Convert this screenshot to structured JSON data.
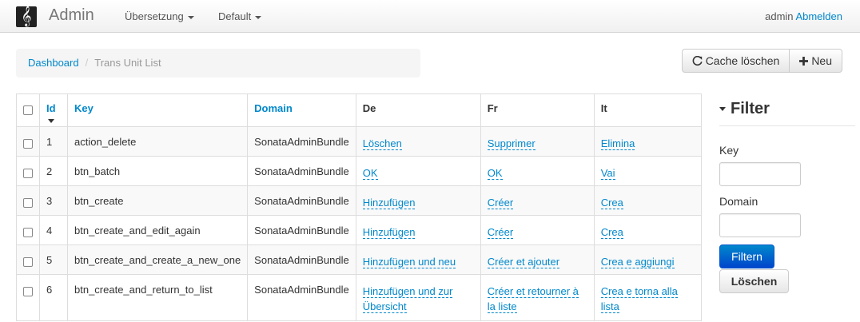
{
  "navbar": {
    "brand": "Admin",
    "menu": [
      {
        "label": "Übersetzung"
      },
      {
        "label": "Default"
      }
    ],
    "user": "admin",
    "logout": "Abmelden"
  },
  "breadcrumb": {
    "home": "Dashboard",
    "current": "Trans Unit List"
  },
  "actions": {
    "cache_clear": "Cache löschen",
    "new": "Neu"
  },
  "table": {
    "headers": {
      "id": "Id",
      "key": "Key",
      "domain": "Domain",
      "de": "De",
      "fr": "Fr",
      "it": "It"
    },
    "rows": [
      {
        "id": "1",
        "key": "action_delete",
        "domain": "SonataAdminBundle",
        "de": "Löschen",
        "fr": "Supprimer",
        "it": "Elimina"
      },
      {
        "id": "2",
        "key": "btn_batch",
        "domain": "SonataAdminBundle",
        "de": "OK",
        "fr": "OK",
        "it": "Vai"
      },
      {
        "id": "3",
        "key": "btn_create",
        "domain": "SonataAdminBundle",
        "de": "Hinzufügen",
        "fr": "Créer",
        "it": "Crea"
      },
      {
        "id": "4",
        "key": "btn_create_and_edit_again",
        "domain": "SonataAdminBundle",
        "de": "Hinzufügen",
        "fr": "Créer",
        "it": "Crea"
      },
      {
        "id": "5",
        "key": "btn_create_and_create_a_new_one",
        "domain": "SonataAdminBundle",
        "de": "Hinzufügen und neu",
        "fr": "Créer et ajouter",
        "it": "Crea e aggiungi"
      },
      {
        "id": "6",
        "key": "btn_create_and_return_to_list",
        "domain": "SonataAdminBundle",
        "de": "Hinzufügen und zur Übersicht",
        "fr": "Créer et retourner à la liste",
        "it": "Crea e torna alla lista"
      }
    ]
  },
  "filter": {
    "title": "Filter",
    "key_label": "Key",
    "key_value": "",
    "domain_label": "Domain",
    "domain_value": "",
    "submit": "Filtern",
    "reset": "Löschen"
  },
  "colors": {
    "link": "#0088cc",
    "primary": "#0044cc"
  }
}
